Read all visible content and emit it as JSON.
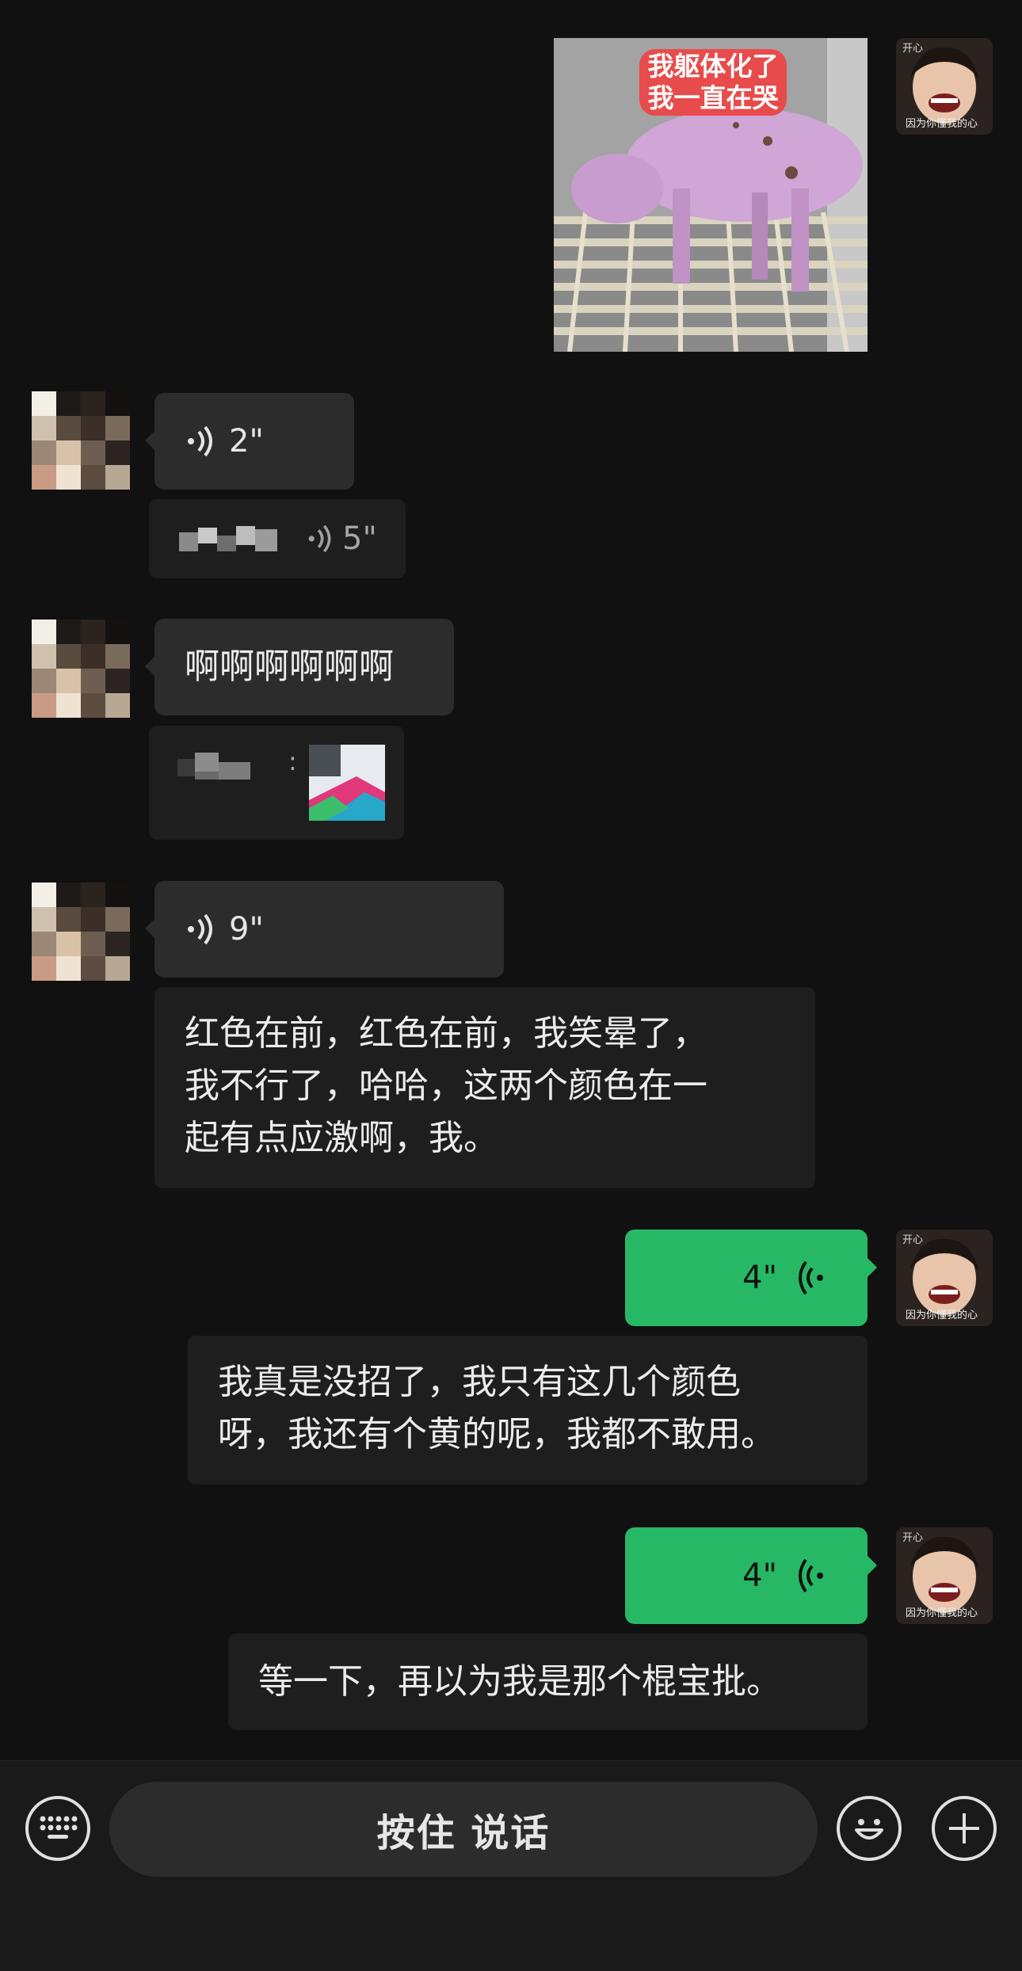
{
  "messages": {
    "m1_image": {
      "caption_line1": "我躯体化了",
      "caption_line2": "我一直在哭"
    },
    "m2_voice": {
      "duration": "2\""
    },
    "m3_quote_voice": {
      "duration": "5\""
    },
    "m4_text": {
      "text": "啊啊啊啊啊啊"
    },
    "m5_quote_image": {
      "separator": ":"
    },
    "m6_voice": {
      "duration": "9\""
    },
    "m7_transcript": {
      "line1": "红色在前，红色在前，我笑晕了，",
      "line2": "我不行了，哈哈，这两个颜色在一",
      "line3": "起有点应激啊，我。"
    },
    "m8_voice": {
      "duration": "4\""
    },
    "m9_transcript": {
      "line1": "我真是没招了，我只有这几个颜色",
      "line2": "呀，我还有个黄的呢，我都不敢用。"
    },
    "m10_voice": {
      "duration": "4\""
    },
    "m11_transcript": {
      "text": "等一下，再以为我是那个棍宝批。"
    }
  },
  "self_avatar": {
    "top_text": "开心",
    "bottom_text": "因为你懂我的心"
  },
  "input_bar": {
    "hold_to_talk_label": "按住 说话",
    "left_icon": "keyboard-icon",
    "right_icons": [
      "emoji-icon",
      "plus-icon"
    ]
  },
  "colors": {
    "background": "#111111",
    "bubble_peer": "#2c2c2c",
    "bubble_self": "#27b865",
    "bar": "#1a1a1a"
  }
}
